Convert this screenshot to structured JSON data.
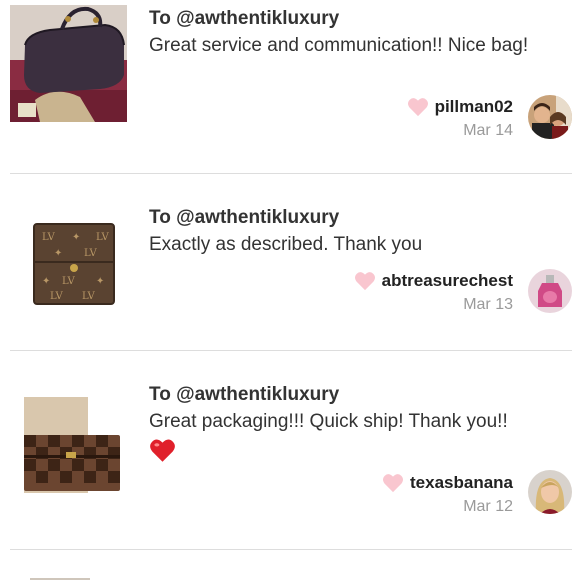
{
  "reviews": [
    {
      "to": "To @awthentikluxury",
      "comment": "Great service and communication!! Nice bag!",
      "username": "pillman02",
      "date": "Mar 14",
      "thumb_icon": "brown-leather-duffel-bag-photo",
      "avatar_icon": "couple-photo-avatar"
    },
    {
      "to": "To @awthentikluxury",
      "comment": "Exactly as described. Thank you",
      "username": "abtreasurechest",
      "date": "Mar 13",
      "thumb_icon": "monogram-wallet-photo",
      "avatar_icon": "pink-bottle-avatar"
    },
    {
      "to": "To @awthentikluxury",
      "comment": "Great packaging!!! Quick ship! Thank you!! ",
      "comment_emoji": "red-heart-emoji",
      "username": "texasbanana",
      "date": "Mar 12",
      "thumb_icon": "checkered-wallet-photo",
      "avatar_icon": "blonde-woman-avatar"
    }
  ],
  "colors": {
    "like_heart": "#f9c6cf",
    "text": "#333333",
    "date": "#9a9a9a",
    "divider": "#dddddd",
    "emoji_heart": "#e0202b"
  }
}
